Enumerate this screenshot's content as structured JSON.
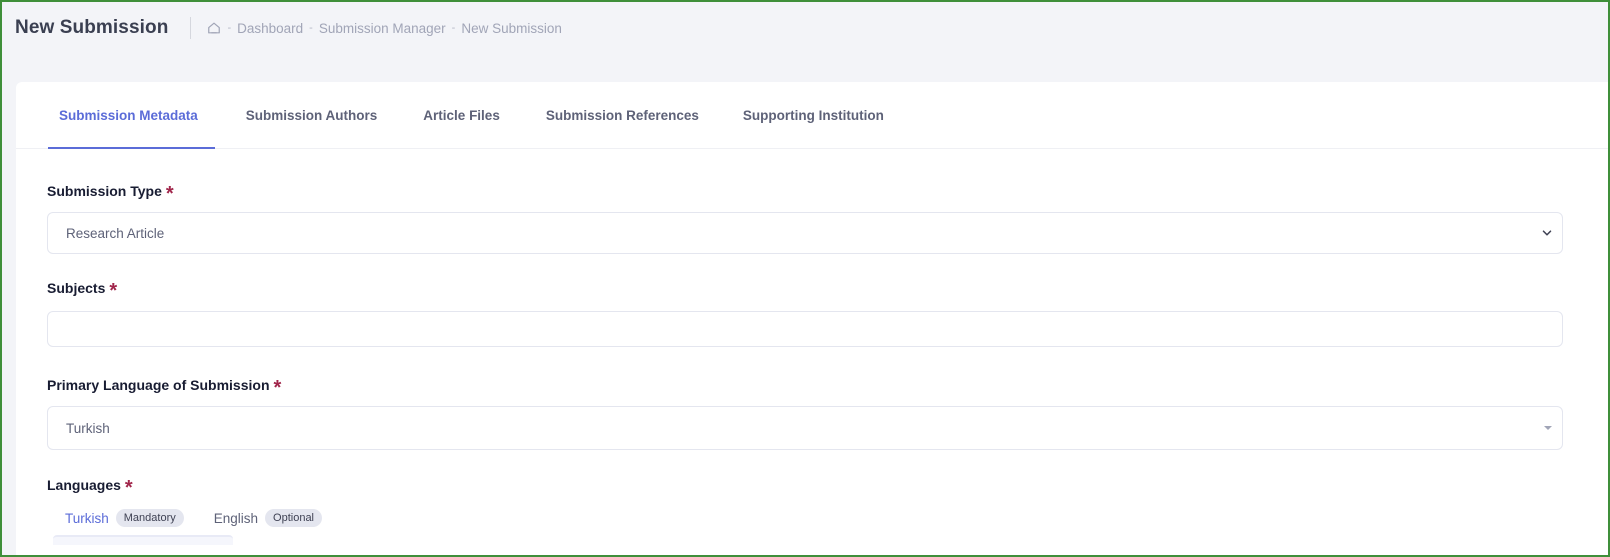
{
  "header": {
    "title": "New Submission",
    "breadcrumb": {
      "separator": "-",
      "items": [
        "Dashboard",
        "Submission Manager",
        "New Submission"
      ]
    }
  },
  "tabs": [
    {
      "label": "Submission Metadata",
      "active": true
    },
    {
      "label": "Submission Authors",
      "active": false
    },
    {
      "label": "Article Files",
      "active": false
    },
    {
      "label": "Submission References",
      "active": false
    },
    {
      "label": "Supporting Institution",
      "active": false
    }
  ],
  "form": {
    "required_mark": "*",
    "submission_type": {
      "label": "Submission Type",
      "value": "Research Article"
    },
    "subjects": {
      "label": "Subjects",
      "value": ""
    },
    "primary_language": {
      "label": "Primary Language of Submission",
      "value": "Turkish"
    },
    "languages": {
      "label": "Languages",
      "items": [
        {
          "name": "Turkish",
          "badge": "Mandatory",
          "active": true
        },
        {
          "name": "English",
          "badge": "Optional",
          "active": false
        }
      ]
    }
  },
  "colors": {
    "accent": "#5b6cd8",
    "required": "#a1264b",
    "frame_border": "#3f8f3a"
  }
}
